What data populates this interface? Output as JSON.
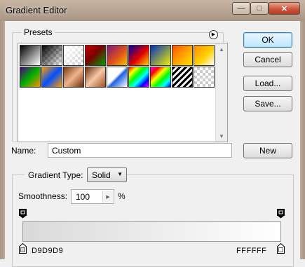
{
  "window": {
    "title": "Gradient Editor"
  },
  "titlebar_buttons": {
    "minimize": "—",
    "maximize": "□",
    "close": "✕"
  },
  "presets": {
    "label": "Presets",
    "menu_icon": "▶",
    "swatches": [
      "linear-gradient(135deg,#000 0%,#fff 100%)",
      "linear-gradient(135deg,#000 0%,rgba(0,0,0,0) 100%),repeating-conic-gradient(#ccc 0 25%,#fff 0 50%) 0 0/8px 8px",
      "linear-gradient(135deg,#fff 0%,rgba(255,255,255,0) 100%),repeating-conic-gradient(#ccc 0 25%,#fff 0 50%) 0 0/8px 8px",
      "linear-gradient(135deg,#cc0000,#7a0000 45%,#00a000)",
      "linear-gradient(135deg,#7a1a7a,#e0501a 55%,#f5c000)",
      "linear-gradient(135deg,#0000a0,#e00000 55%,#ffd700)",
      "linear-gradient(135deg,#0030c0,#f0f000)",
      "linear-gradient(135deg,#ff5000,#ffa000 50%,#ffe000)",
      "linear-gradient(135deg,#ff8c00,#ffd000 55%,rgba(255,255,255,0))",
      "linear-gradient(135deg,#4b0082,#00b000 50%,#ff8c00)",
      "linear-gradient(135deg,#ff9a00,#0050ff 50%,#ff9a00)",
      "linear-gradient(135deg,#7a3a10,#f0b48c 50%,#6a2a0a)",
      "linear-gradient(135deg,#6a2a0a,#f5c8a8 50%,#a05020)",
      "linear-gradient(135deg,#fff 45%,#2060e0 55%,#fff)",
      "linear-gradient(135deg,#ff0000,#ffff00 20%,#00ff00 40%,#00ffff 60%,#0000ff 80%,#ff00ff)",
      "linear-gradient(135deg,#ff00ff,#ff0000 20%,#ffff00 40%,#00ff00 60%,#00ffff 80%,#0000ff)",
      "repeating-linear-gradient(135deg,#000 0 3px,#fff 3px 6px)",
      "repeating-conic-gradient(#ccc 0 25%,#fff 0 50%) 0 0/8px 8px"
    ]
  },
  "buttons": {
    "ok": "OK",
    "cancel": "Cancel",
    "load": "Load...",
    "save": "Save...",
    "new": "New"
  },
  "name_field": {
    "label": "Name:",
    "value": "Custom"
  },
  "gradient": {
    "type_label": "Gradient Type:",
    "type_value": "Solid",
    "smoothness_label": "Smoothness:",
    "smoothness_value": "100",
    "smoothness_unit": "%",
    "start_color": "D9D9D9",
    "end_color": "FFFFFF"
  }
}
